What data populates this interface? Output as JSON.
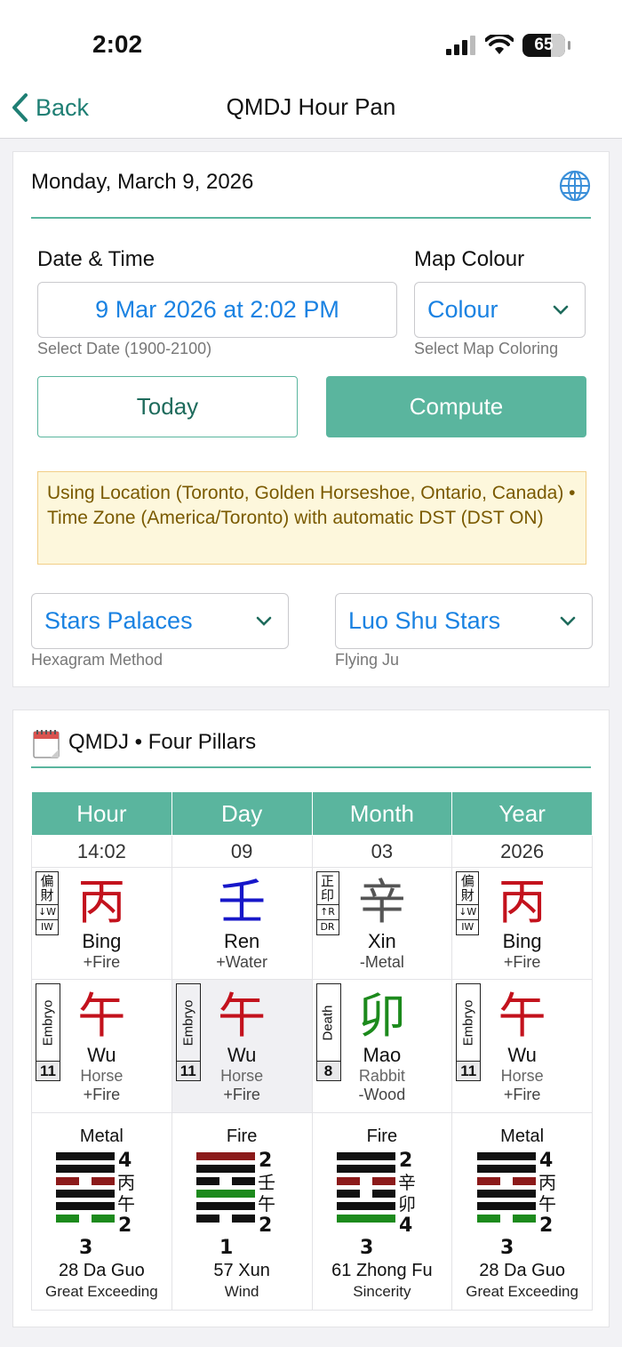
{
  "status": {
    "time": "2:02",
    "battery": "65"
  },
  "nav": {
    "back": "Back",
    "title": "QMDJ Hour Pan"
  },
  "form": {
    "date_heading": "Monday, March 9, 2026",
    "date_time_label": "Date & Time",
    "date_time_value": "9 Mar 2026 at 2:02 PM",
    "date_time_helper": "Select Date (1900-2100)",
    "map_colour_label": "Map Colour",
    "map_colour_value": "Colour",
    "map_colour_helper": "Select Map Coloring",
    "today_button": "Today",
    "compute_button": "Compute",
    "notice": "Using Location (Toronto, Golden Horseshoe, Ontario, Canada) • Time Zone (America/Toronto) with automatic DST (DST ON)",
    "hexagram_method_value": "Stars Palaces",
    "hexagram_method_helper": "Hexagram Method",
    "flying_ju_value": "Luo Shu Stars",
    "flying_ju_helper": "Flying Ju"
  },
  "pillars_section": {
    "title": "QMDJ • Four Pillars"
  },
  "pillars": [
    {
      "header": "Hour",
      "value": "14:02",
      "stem": {
        "char": "丙",
        "pinyin": "Bing",
        "element": "+Fire",
        "color": "#c3121d"
      },
      "god": {
        "name": "偏財",
        "mark": "↓W",
        "abbr": "IW"
      },
      "branch": {
        "char": "午",
        "pinyin": "Wu",
        "animal": "Horse",
        "element": "+Fire",
        "color": "#c3121d",
        "stage": "Embryo",
        "stage_num": "11"
      },
      "hex": {
        "element": "Metal",
        "upper_num": "4",
        "stem": "丙",
        "branch": "午",
        "lower_num": "2",
        "bottom_num": "3",
        "name": "28 Da Guo",
        "english": "Great Exceeding",
        "lines": [
          "yang",
          "yang",
          "yin",
          "yang",
          "yang",
          "yin"
        ],
        "colors": [
          "#111",
          "#111",
          "#8b1a1a",
          "#111",
          "#111",
          "#1c8a1c"
        ]
      }
    },
    {
      "header": "Day",
      "value": "09",
      "stem": {
        "char": "壬",
        "pinyin": "Ren",
        "element": "+Water",
        "color": "#1717c9"
      },
      "god": null,
      "branch": {
        "char": "午",
        "pinyin": "Wu",
        "animal": "Horse",
        "element": "+Fire",
        "color": "#c3121d",
        "stage": "Embryo",
        "stage_num": "11"
      },
      "hex": {
        "element": "Fire",
        "upper_num": "2",
        "stem": "壬",
        "branch": "午",
        "lower_num": "2",
        "bottom_num": "1",
        "name": "57 Xun",
        "english": "Wind",
        "lines": [
          "yang",
          "yang",
          "yin",
          "yang",
          "yang",
          "yin"
        ],
        "colors": [
          "#8b1a1a",
          "#111",
          "#111",
          "#1c8a1c",
          "#111",
          "#111"
        ]
      }
    },
    {
      "header": "Month",
      "value": "03",
      "stem": {
        "char": "辛",
        "pinyin": "Xin",
        "element": "-Metal",
        "color": "#555555"
      },
      "god": {
        "name": "正印",
        "mark": "↑R",
        "abbr": "DR"
      },
      "branch": {
        "char": "卯",
        "pinyin": "Mao",
        "animal": "Rabbit",
        "element": "-Wood",
        "color": "#1c8a1c",
        "stage": "Death",
        "stage_num": "8"
      },
      "hex": {
        "element": "Fire",
        "upper_num": "2",
        "stem": "辛",
        "branch": "卯",
        "lower_num": "4",
        "bottom_num": "3",
        "name": "61 Zhong Fu",
        "english": "Sincerity",
        "lines": [
          "yang",
          "yang",
          "yin",
          "yin",
          "yang",
          "yang"
        ],
        "colors": [
          "#111",
          "#111",
          "#8b1a1a",
          "#111",
          "#111",
          "#1c8a1c"
        ]
      }
    },
    {
      "header": "Year",
      "value": "2026",
      "stem": {
        "char": "丙",
        "pinyin": "Bing",
        "element": "+Fire",
        "color": "#c3121d"
      },
      "god": {
        "name": "偏財",
        "mark": "↓W",
        "abbr": "IW"
      },
      "branch": {
        "char": "午",
        "pinyin": "Wu",
        "animal": "Horse",
        "element": "+Fire",
        "color": "#c3121d",
        "stage": "Embryo",
        "stage_num": "11"
      },
      "hex": {
        "element": "Metal",
        "upper_num": "4",
        "stem": "丙",
        "branch": "午",
        "lower_num": "2",
        "bottom_num": "3",
        "name": "28 Da Guo",
        "english": "Great Exceeding",
        "lines": [
          "yang",
          "yang",
          "yin",
          "yang",
          "yang",
          "yin"
        ],
        "colors": [
          "#111",
          "#111",
          "#8b1a1a",
          "#111",
          "#111",
          "#1c8a1c"
        ]
      }
    }
  ],
  "colors": {
    "accent": "#5ab59e",
    "link": "#1a82e2",
    "notice_bg": "#fdf7dc",
    "notice_text": "#7a5a00"
  }
}
